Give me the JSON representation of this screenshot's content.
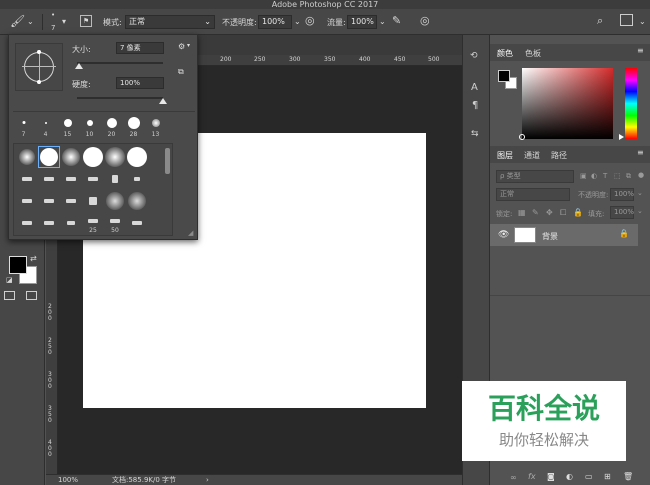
{
  "app": {
    "title": "Adobe Photoshop CC 2017"
  },
  "options_bar": {
    "brush_size": "7",
    "mode_label": "模式:",
    "mode_value": "正常",
    "opacity_label": "不透明度:",
    "opacity_value": "100%",
    "flow_label": "流量:",
    "flow_value": "100%"
  },
  "brush_popup": {
    "size_label": "大小:",
    "size_value": "7 像素",
    "hardness_label": "硬度:",
    "hardness_value": "100%",
    "size_fraction": 0.02,
    "hardness_fraction": 1.0,
    "recent_sizes": [
      "7",
      "4",
      "15",
      "10",
      "20",
      "28",
      "13"
    ],
    "preset_numbers": [
      "25",
      "50"
    ]
  },
  "rulers": {
    "top_ticks": [
      "200",
      "250",
      "300",
      "350",
      "400",
      "450",
      "500"
    ],
    "left_ticks": [
      "2 0 0",
      "2 5 0",
      "3 0 0",
      "3 5 0",
      "4 0 0"
    ]
  },
  "status": {
    "zoom": "100%",
    "doc_info": "文档:585.9K/0 字节"
  },
  "color_panel": {
    "tab_color": "颜色",
    "tab_swatches": "色板",
    "foreground_color": "#000000",
    "background_color": "#ffffff",
    "picker_hue_color": "#d32b2b"
  },
  "layers_panel": {
    "tab_layers": "图层",
    "tab_channels": "通道",
    "tab_paths": "路径",
    "filter_placeholder": "ρ 类型",
    "blend_mode": "正常",
    "opacity_label": "不透明度:",
    "opacity_value": "100%",
    "lock_label": "锁定:",
    "fill_label": "填充:",
    "fill_value": "100%",
    "layers": [
      {
        "name": "背景",
        "visible": true,
        "locked": true
      }
    ],
    "footer_fx": "fx"
  },
  "watermark": {
    "title": "百科全说",
    "subtitle": "助你轻松解决"
  }
}
